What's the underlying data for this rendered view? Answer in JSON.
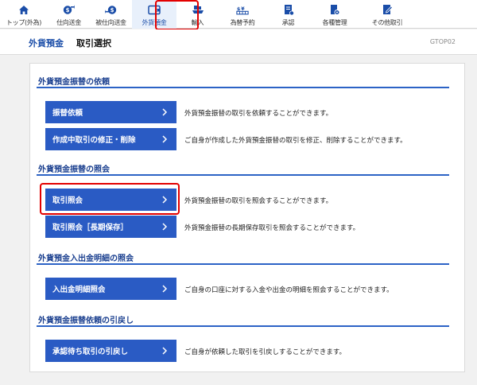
{
  "nav": {
    "items": [
      {
        "label": "トップ(外為)",
        "icon": "home-icon"
      },
      {
        "label": "仕向送金",
        "icon": "outbound-remittance-icon"
      },
      {
        "label": "被仕向送金",
        "icon": "inbound-remittance-icon"
      },
      {
        "label": "外貨預金",
        "icon": "foreign-deposit-icon"
      },
      {
        "label": "輸入",
        "icon": "import-icon"
      },
      {
        "label": "為替予約",
        "icon": "exchange-contract-icon"
      },
      {
        "label": "承認",
        "icon": "approval-icon"
      },
      {
        "label": "各種管理",
        "icon": "management-icon"
      },
      {
        "label": "その他取引",
        "icon": "other-transactions-icon"
      }
    ],
    "active": "外貨預金"
  },
  "header": {
    "category": "外貨預金",
    "title": "取引選択",
    "screen_id": "GTOP02"
  },
  "sections": [
    {
      "title": "外貨預金振替の依頼",
      "buttons": [
        {
          "label": "振替依頼",
          "desc": "外貨預金振替の取引を依頼することができます。"
        },
        {
          "label": "作成中取引の修正・削除",
          "desc": "ご自身が作成した外貨預金振替の取引を修正、削除することができます。"
        }
      ]
    },
    {
      "title": "外貨預金振替の照会",
      "buttons": [
        {
          "label": "取引照会",
          "desc": "外貨預金振替の取引を照会することができます。"
        },
        {
          "label": "取引照会［長期保存］",
          "desc": "外貨預金振替の長期保存取引を照会することができます。"
        }
      ]
    },
    {
      "title": "外貨預金入出金明細の照会",
      "buttons": [
        {
          "label": "入出金明細照会",
          "desc": "ご自身の口座に対する入金や出金の明細を照会することができます。"
        }
      ]
    },
    {
      "title": "外貨預金振替依頼の引戻し",
      "buttons": [
        {
          "label": "承認待ち取引の引戻し",
          "desc": "ご自身が依頼した取引を引戻しすることができます。"
        }
      ]
    }
  ],
  "colors": {
    "accent": "#2a5bc4",
    "section_title": "#1a3f8f",
    "highlight": "#e30000"
  }
}
